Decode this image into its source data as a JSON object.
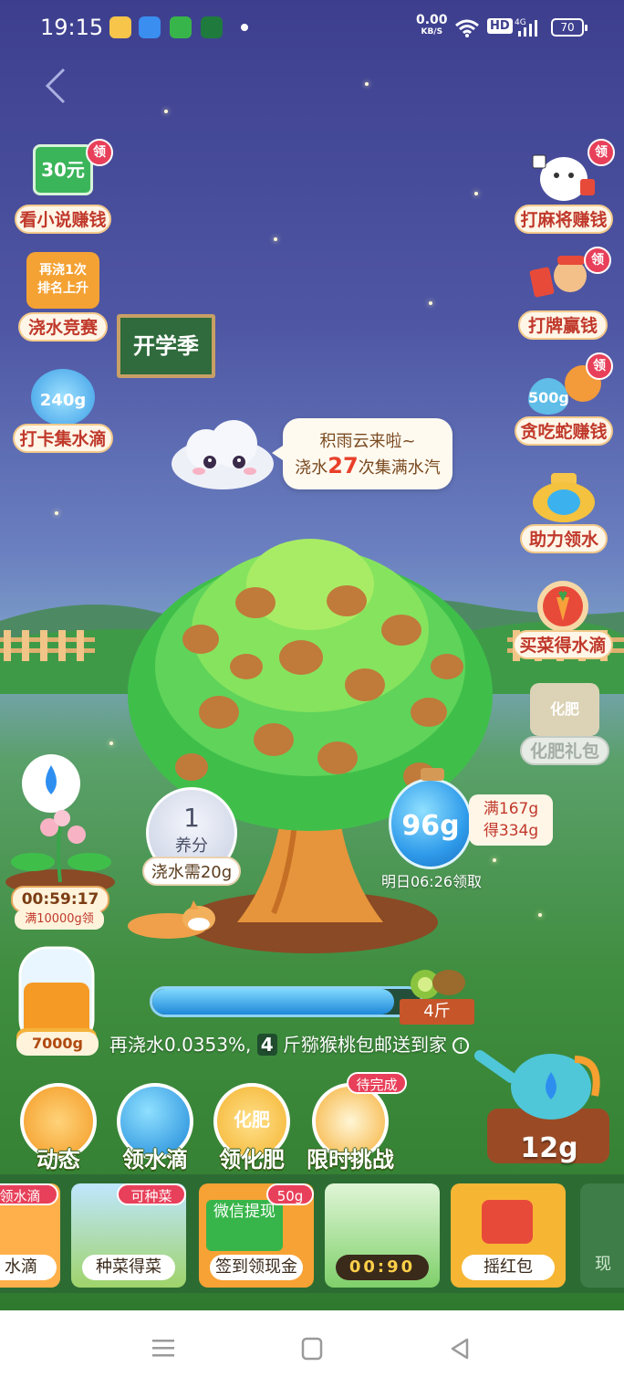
{
  "status_bar": {
    "time": "19:15",
    "net_speed": "0.00",
    "net_unit": "KB/S",
    "hd": "HD",
    "signal": "4G",
    "battery": "70"
  },
  "left_buttons": [
    {
      "art": "30元",
      "label": "看小说赚钱",
      "badge": "领"
    },
    {
      "art": "再浇1次\n排名上升",
      "label": "浇水竞赛"
    },
    {
      "art": "240g",
      "label": "打卡集水滴"
    }
  ],
  "right_buttons": [
    {
      "label": "打麻将赚钱",
      "badge": "领",
      "icon": "lucky-cat-icon"
    },
    {
      "label": "打牌赢钱",
      "badge": "领",
      "icon": "cards-man-icon"
    },
    {
      "art": "500g",
      "label": "贪吃蛇赚钱",
      "badge": "领",
      "icon": "snake-icon"
    },
    {
      "label": "助力领水",
      "icon": "help-water-icon"
    },
    {
      "label": "买菜得水滴",
      "icon": "carrot-icon"
    },
    {
      "art": "化肥",
      "label": "化肥礼包",
      "icon": "fertilizer-bag-icon",
      "disabled": true
    }
  ],
  "blackboard": "开学季",
  "cloud_bubble": {
    "line1": "积雨云来啦~",
    "line2_pre": "浇水",
    "line2_num": "27",
    "line2_post": "次集满水汽"
  },
  "nutrient": {
    "value": "1",
    "label": "养分",
    "need": "浇水需20g"
  },
  "water_jar": {
    "amount": "96g",
    "tip_line1": "满167g",
    "tip_line2": "得334g",
    "collect_time": "明日06:26领取"
  },
  "flower": {
    "timer": "00:59:17",
    "sub": "满10000g领"
  },
  "progress": {
    "fraction": 0.9,
    "prize_label": "4斤",
    "text_pre": "再浇水0.0353%,",
    "text_amount": "4",
    "text_post": "斤猕猴桃包邮送到家",
    "info_icon": "i"
  },
  "bottle": {
    "amount": "7000g"
  },
  "actions": [
    {
      "label": "动态",
      "icon": "news-icon"
    },
    {
      "label": "领水滴",
      "icon": "water-drop-icon"
    },
    {
      "label": "领化肥",
      "icon": "fertilizer-icon",
      "art": "化肥"
    },
    {
      "label": "限时挑战",
      "icon": "clock-icon",
      "badge": "待完成"
    }
  ],
  "watering_can": {
    "amount": "12g"
  },
  "cards": [
    {
      "label": "水滴",
      "tag": "领水滴"
    },
    {
      "label": "种菜得菜",
      "tag": "可种菜"
    },
    {
      "label": "签到领现金",
      "tag": "50g",
      "art": "微信提现"
    },
    {
      "label": "00:90",
      "tag": ""
    },
    {
      "label": "摇红包",
      "tag": ""
    },
    {
      "label": "现",
      "tag": ""
    }
  ],
  "colors": {
    "accent_red": "#e8405a",
    "label_text": "#c0392b",
    "grass": "#2c6c33"
  }
}
